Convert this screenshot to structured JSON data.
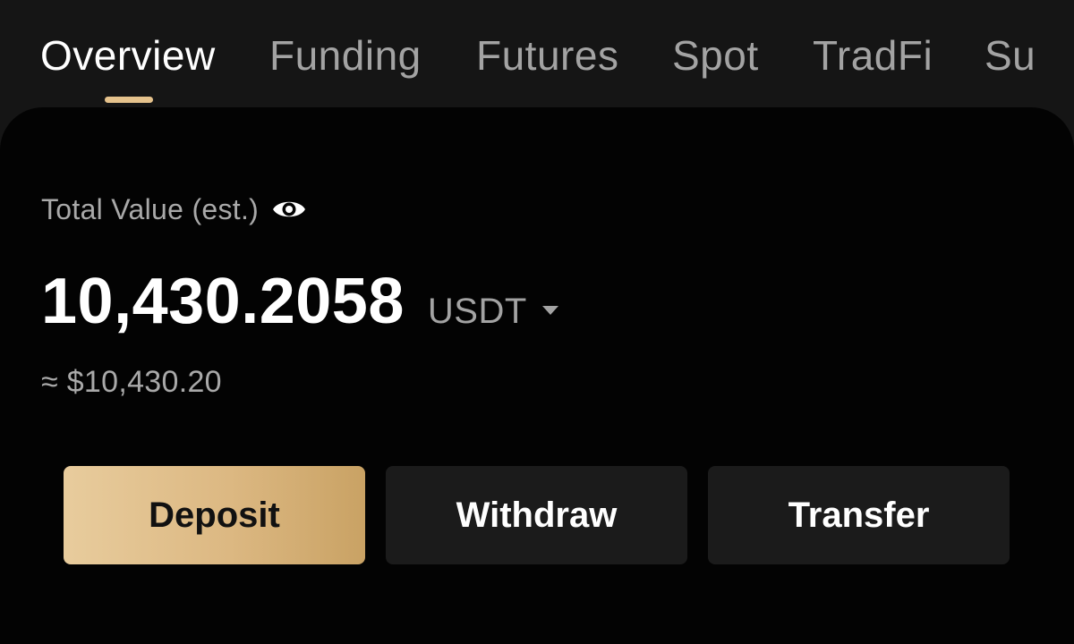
{
  "tabs": [
    {
      "label": "Overview",
      "active": true
    },
    {
      "label": "Funding",
      "active": false
    },
    {
      "label": "Futures",
      "active": false
    },
    {
      "label": "Spot",
      "active": false
    },
    {
      "label": "TradFi",
      "active": false
    },
    {
      "label": "Su",
      "active": false
    }
  ],
  "summary": {
    "total_label": "Total Value (est.)",
    "amount": "10,430.2058",
    "currency": "USDT",
    "approx": "≈ $10,430.20"
  },
  "actions": {
    "deposit_label": "Deposit",
    "withdraw_label": "Withdraw",
    "transfer_label": "Transfer"
  },
  "icons": {
    "eye": "eye-icon",
    "caret": "caret-down-icon"
  },
  "colors": {
    "accent": "#e5c28c",
    "background": "#151515",
    "card": "#030303",
    "secondary_button": "#1b1b1b"
  }
}
